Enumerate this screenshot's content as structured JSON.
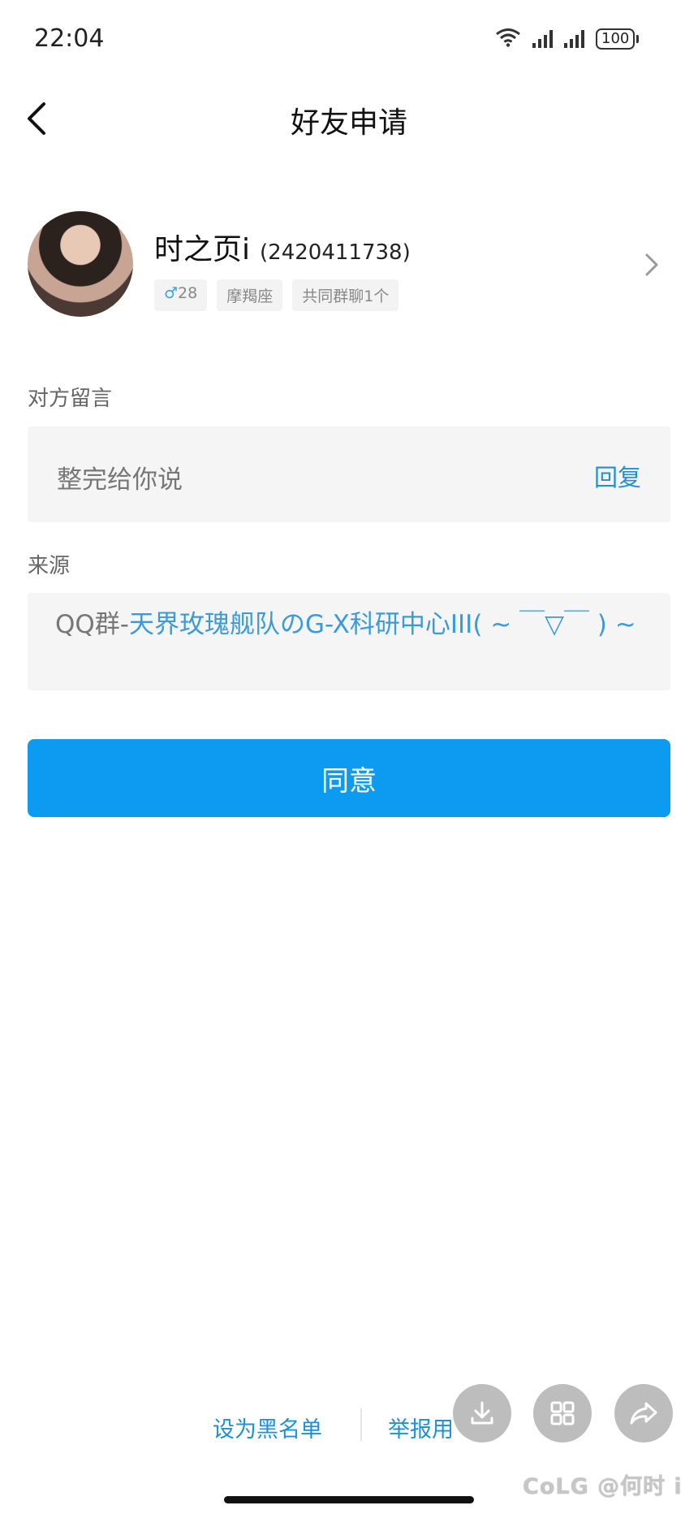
{
  "status_bar": {
    "time": "22:04",
    "battery": "100",
    "icons": [
      "wifi-icon",
      "signal-icon",
      "signal-icon",
      "battery-icon"
    ]
  },
  "nav": {
    "title": "好友申请",
    "back_icon": "chevron-left-icon"
  },
  "profile": {
    "nickname": "时之页i",
    "qq_id": "(2420411738)",
    "tags": {
      "gender_symbol": "♂",
      "age": "28",
      "zodiac": "摩羯座",
      "common_groups": "共同群聊1个"
    },
    "arrow_icon": "chevron-right-icon"
  },
  "message_section": {
    "label": "对方留言",
    "message": "整完给你说",
    "reply_label": "回复"
  },
  "source_section": {
    "label": "来源",
    "prefix": "QQ群-",
    "group_name": "天界玫瑰舰队のG-X科研中心III( ~ ￣▽￣ ) ~"
  },
  "agree_button": {
    "label": "同意"
  },
  "bottom_links": {
    "blacklist": "设为黑名单",
    "report": "举报用"
  },
  "floating_actions": [
    "download-icon",
    "grid-icon",
    "share-icon"
  ],
  "watermark": "CoLG @何时 i",
  "colors": {
    "accent": "#0d9bf2",
    "link": "#1e90d6",
    "box_bg": "#f5f5f5"
  }
}
